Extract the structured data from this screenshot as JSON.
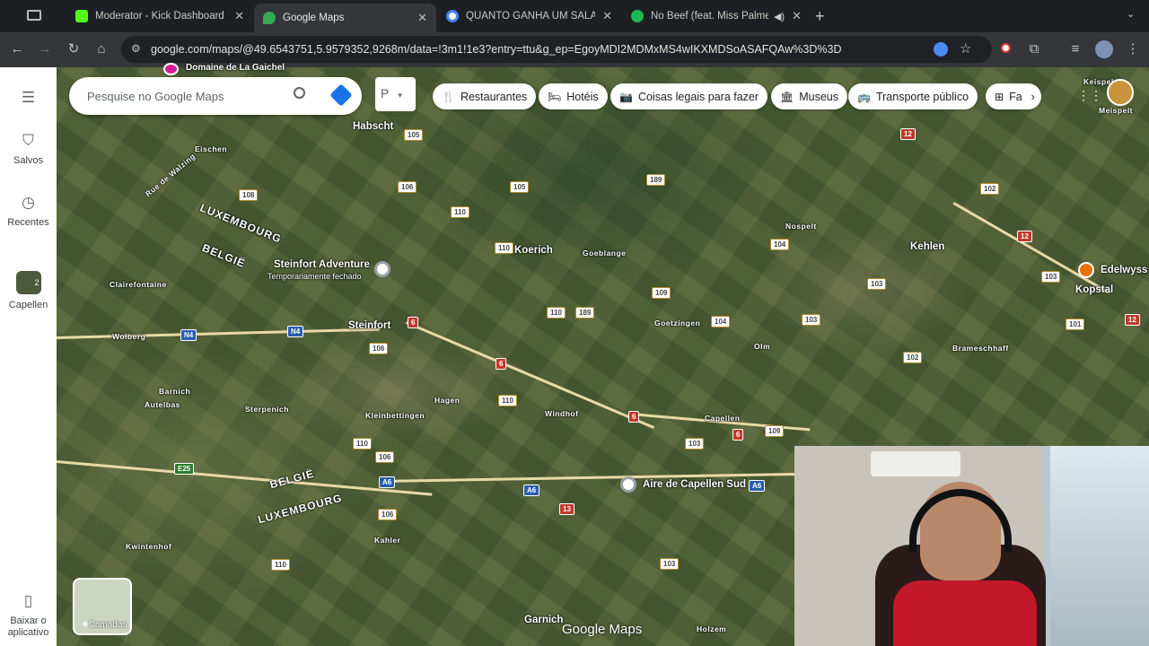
{
  "tabs": [
    {
      "title": "Moderator - Kick Dashboard",
      "favicon_color": "#53fc18"
    },
    {
      "title": "Google Maps",
      "favicon_color": "#34a853"
    },
    {
      "title": "QUANTO GANHA UM SALARI",
      "favicon_color": "#ffffff"
    },
    {
      "title": "No Beef (feat. Miss Palme",
      "favicon_color": "#1db954"
    }
  ],
  "address": {
    "url": "google.com/maps/@49.6543751,5.9579352,9268m/data=!3m1!1e3?entry=ttu&g_ep=EgoyMDI2MDMxMS4wIKXMDSoASAFQAw%3D%3D"
  },
  "sidebar": {
    "items": [
      {
        "label": "Salvos",
        "icon": "bookmark-icon"
      },
      {
        "label": "Recentes",
        "icon": "history-icon"
      },
      {
        "label": "Capellen",
        "icon": "place-thumbnail",
        "badge": "2"
      },
      {
        "label": "Baixar o aplicativo",
        "icon": "phone-icon"
      }
    ]
  },
  "search": {
    "placeholder": "Pesquise no Google Maps"
  },
  "chips": [
    "Restaurantes",
    "Hotéis",
    "Coisas legais para fazer",
    "Museus",
    "Transporte público",
    "Fa"
  ],
  "map_labels": {
    "places": [
      "Habscht",
      "Eischen",
      "Koerich",
      "Goeblange",
      "Nospelt",
      "Kehlen",
      "Kopstal",
      "Edelwyss",
      "Clairefontaine",
      "Steinfort",
      "Wolberg",
      "Goetzingen",
      "Olm",
      "Brameschhaff",
      "Barnich",
      "Autelbas",
      "Sterpenich",
      "Kleinbettingen",
      "Hagen",
      "Windhof",
      "Capellen",
      "Kwintenhof",
      "Kahler",
      "Garnich",
      "Holzem",
      "Domaine de La Gaichel",
      "Keispelt",
      "Meispelt"
    ],
    "pois": [
      {
        "name": "Steinfort Adventure",
        "sub": "Temporariamente fechado"
      },
      {
        "name": "Aire de Capellen Sud"
      }
    ],
    "countries": [
      "LUXEMBOURG",
      "BELGIË",
      "BELGIË",
      "LUXEMBOURG"
    ],
    "street": "Rue de Walzing"
  },
  "layers_label": "Camadas",
  "brand": "Google Maps"
}
